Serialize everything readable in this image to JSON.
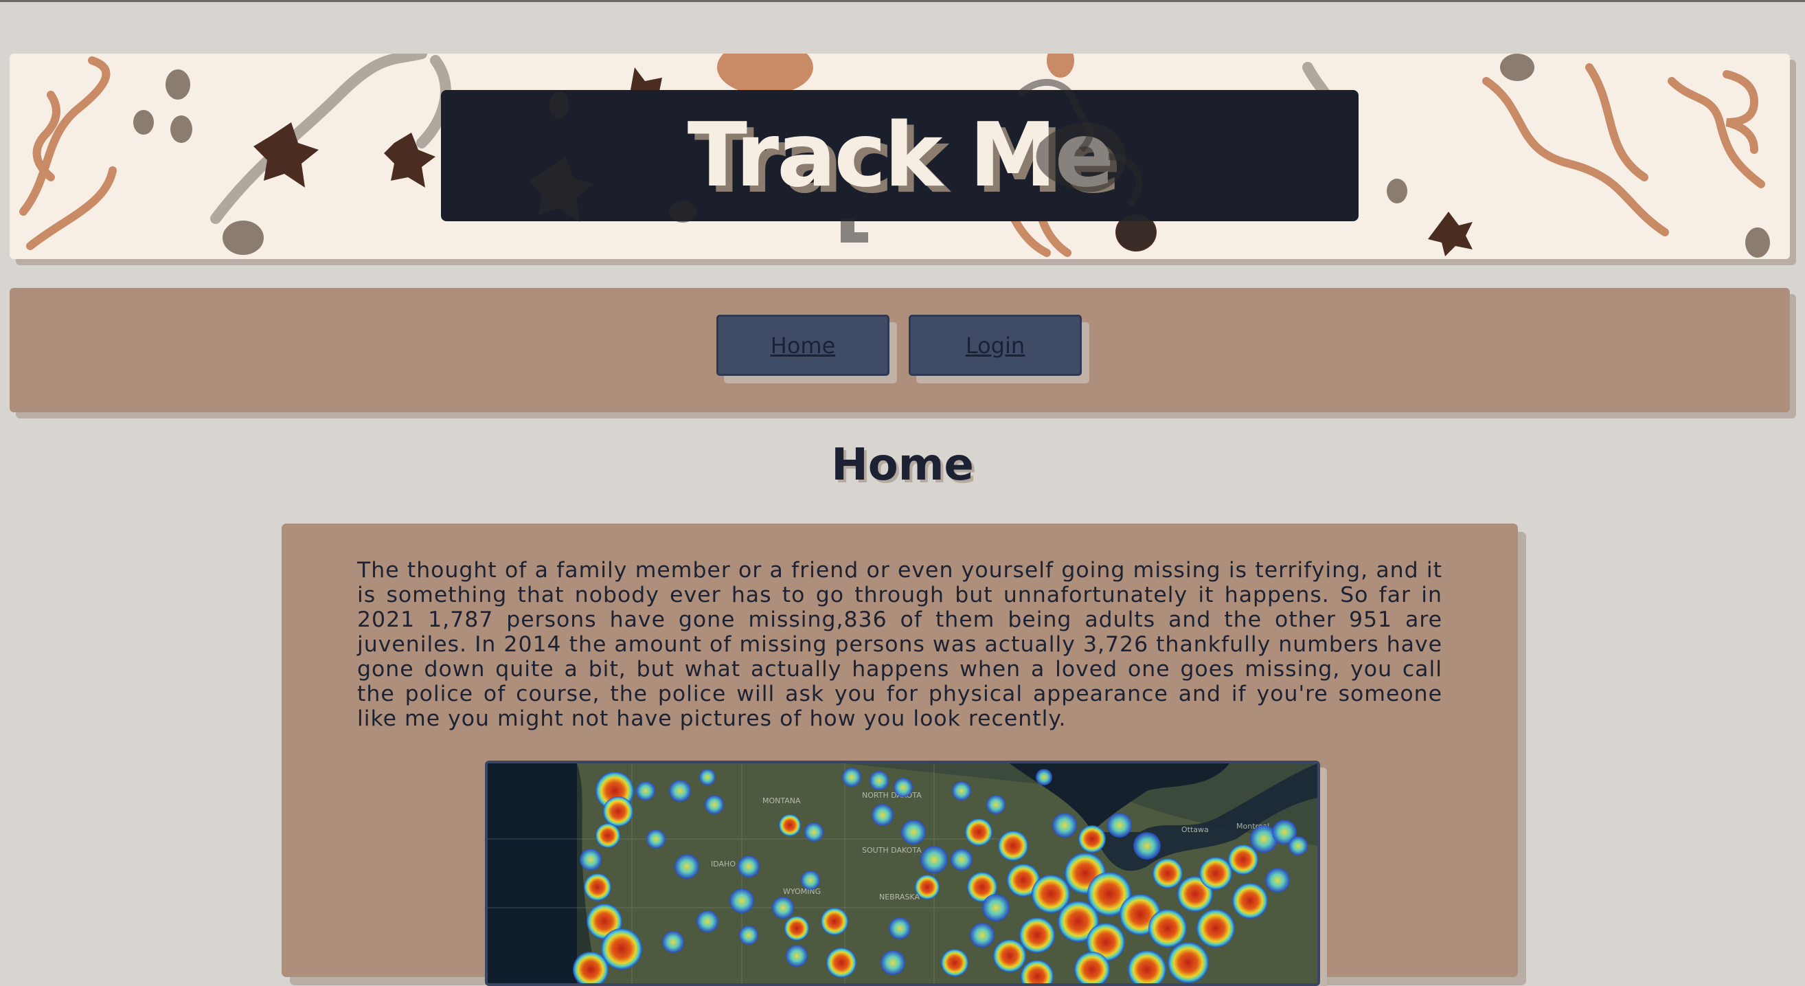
{
  "header": {
    "site_title": "Track Me"
  },
  "nav": {
    "items": [
      {
        "label": "Home"
      },
      {
        "label": "Login"
      }
    ]
  },
  "main": {
    "page_title": "Home",
    "intro_text": "The thought of a family member or a friend or even yourself going missing is terrifying, and it is something that nobody ever has to go through but unnafortunately it happens. So far in 2021 1,787 persons have gone missing,836 of them being adults and the other 951 are juveniles. In 2014 the amount of missing persons was actually 3,726 thankfully numbers have gone down quite a bit, but what actually happens when a loved one goes missing, you call the police of course, the police will ask you for physical appearance and if you're someone like me you might not have pictures of how you look recently.",
    "map": {
      "labels": [
        "MONTANA",
        "NORTH DAKOTA",
        "SOUTH DAKOTA",
        "IDAHO",
        "WYOMING",
        "NEBRASKA",
        "Ottawa",
        "Montreal"
      ]
    }
  },
  "colors": {
    "page_bg": "#d8d5d1",
    "banner_bg": "#f7efe6",
    "title_box": "#1b1f2b",
    "panel": "#ae8f7b",
    "button": "#404b66",
    "text_dark": "#1c2233"
  }
}
